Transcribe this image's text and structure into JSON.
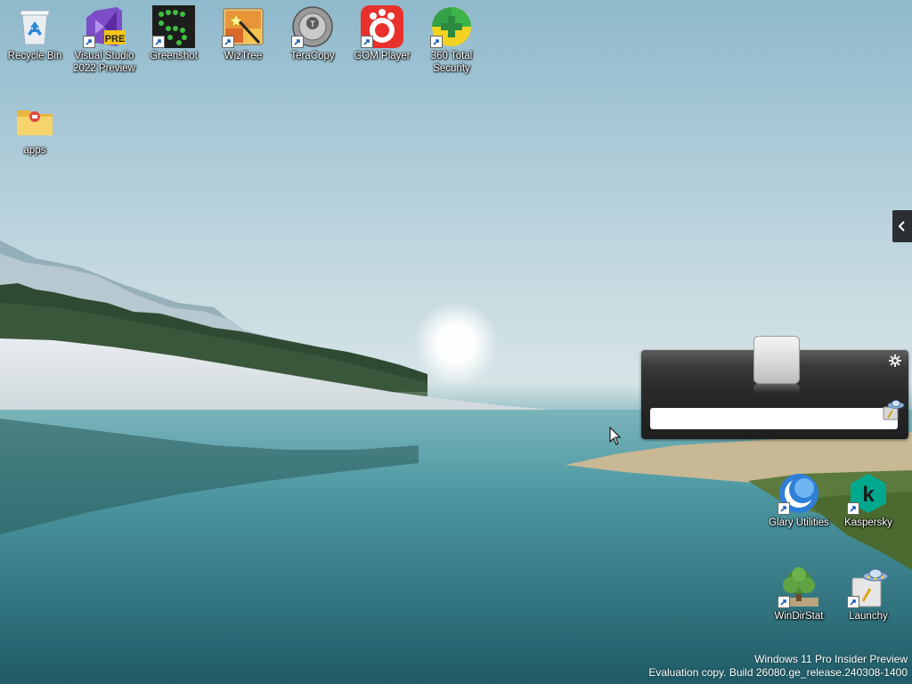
{
  "desktop": {
    "icons": [
      {
        "label": "Recycle Bin",
        "icon": "recycle-bin-icon"
      },
      {
        "label": "Visual Studio 2022 Preview",
        "icon": "visual-studio-icon",
        "badge": "PRE"
      },
      {
        "label": "Greenshot",
        "icon": "greenshot-icon"
      },
      {
        "label": "WizTree",
        "icon": "wiztree-icon"
      },
      {
        "label": "TeraCopy",
        "icon": "teracopy-icon"
      },
      {
        "label": "GOM Player",
        "icon": "gom-player-icon"
      },
      {
        "label": "360 Total Security",
        "icon": "360-total-security-icon"
      },
      {
        "label": "apps",
        "icon": "folder-icon"
      },
      {
        "label": "Glary Utilities",
        "icon": "glary-utilities-icon"
      },
      {
        "label": "Kaspersky",
        "icon": "kaspersky-icon",
        "glyph": "k"
      },
      {
        "label": "WinDirStat",
        "icon": "windirstat-icon"
      },
      {
        "label": "Launchy",
        "icon": "launchy-icon"
      }
    ]
  },
  "launchy": {
    "input_value": "",
    "settings_icon": "gear-icon"
  },
  "watermark": {
    "line1": "Windows 11 Pro Insider Preview",
    "line2": "Evaluation copy. Build 26080.ge_release.240308-1400"
  },
  "colors": {
    "vs_purple": "#7d4dc7",
    "gom_red": "#e8312d",
    "greenshot_green": "#3fbf3f",
    "kaspersky_green": "#00a88e",
    "glary_blue": "#2f7fd8"
  }
}
